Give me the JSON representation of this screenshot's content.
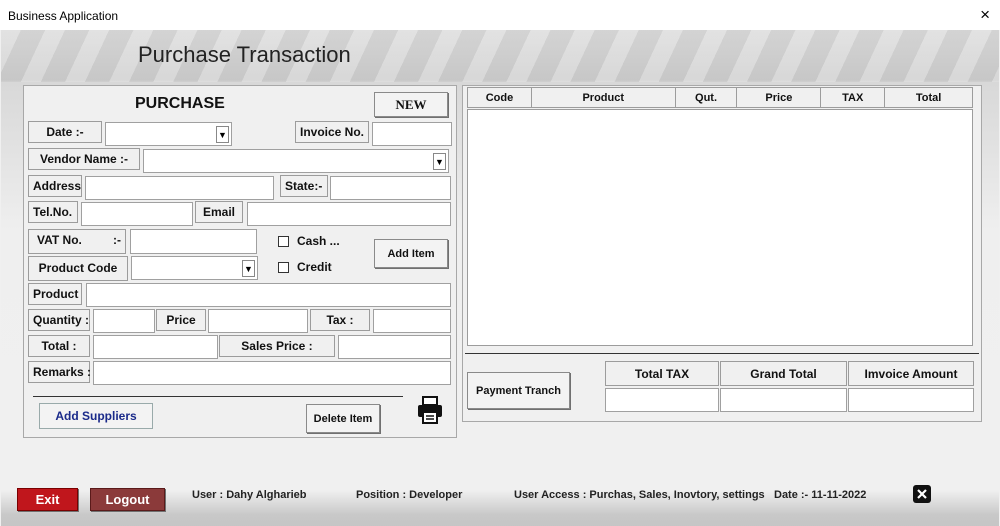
{
  "window": {
    "title": "Business Application",
    "close_glyph": "×"
  },
  "page_title": "Purchase Transaction",
  "form": {
    "heading": "PURCHASE",
    "new_label": "NEW",
    "date_label": "Date  :-",
    "invoice_label": "Invoice No.",
    "vendor_label": "Vendor Name  :-",
    "address_label": "Address",
    "state_label": "State:-",
    "tel_label": "Tel.No.",
    "email_label": "Email",
    "vat_label": "VAT No.",
    "vat_sep": ":-",
    "cash_label": "Cash ...",
    "credit_label": "Credit",
    "add_item_label": "Add  Item",
    "product_code_label": "Product Code",
    "product_label": "Product",
    "quantity_label": "Quantity :",
    "price_label": "Price",
    "tax_label": "Tax :",
    "total_label": "Total :",
    "sales_price_label": "Sales Price :",
    "remarks_label": "Remarks :",
    "add_suppliers_label": "Add Suppliers",
    "delete_item_label": "Delete Item"
  },
  "items_table": {
    "columns": [
      "Code",
      "Product",
      "Qut.",
      "Price",
      "TAX",
      "Total"
    ]
  },
  "totals": {
    "payment_label": "Payment Tranch",
    "total_tax_label": "Total TAX",
    "grand_total_label": "Grand Total",
    "invoice_amount_label": "Imvoice Amount"
  },
  "footer": {
    "exit_label": "Exit",
    "logout_label": "Logout",
    "user": "User : Dahy Algharieb",
    "position": "Position : Developer",
    "access": "User Access : Purchas, Sales, Inovtory, settings",
    "date": "Date  :-  11-11-2022"
  },
  "colors": {
    "exit": "#c0161c",
    "logout": "#8b3a3a",
    "supplier_text": "#1a2a8a"
  }
}
